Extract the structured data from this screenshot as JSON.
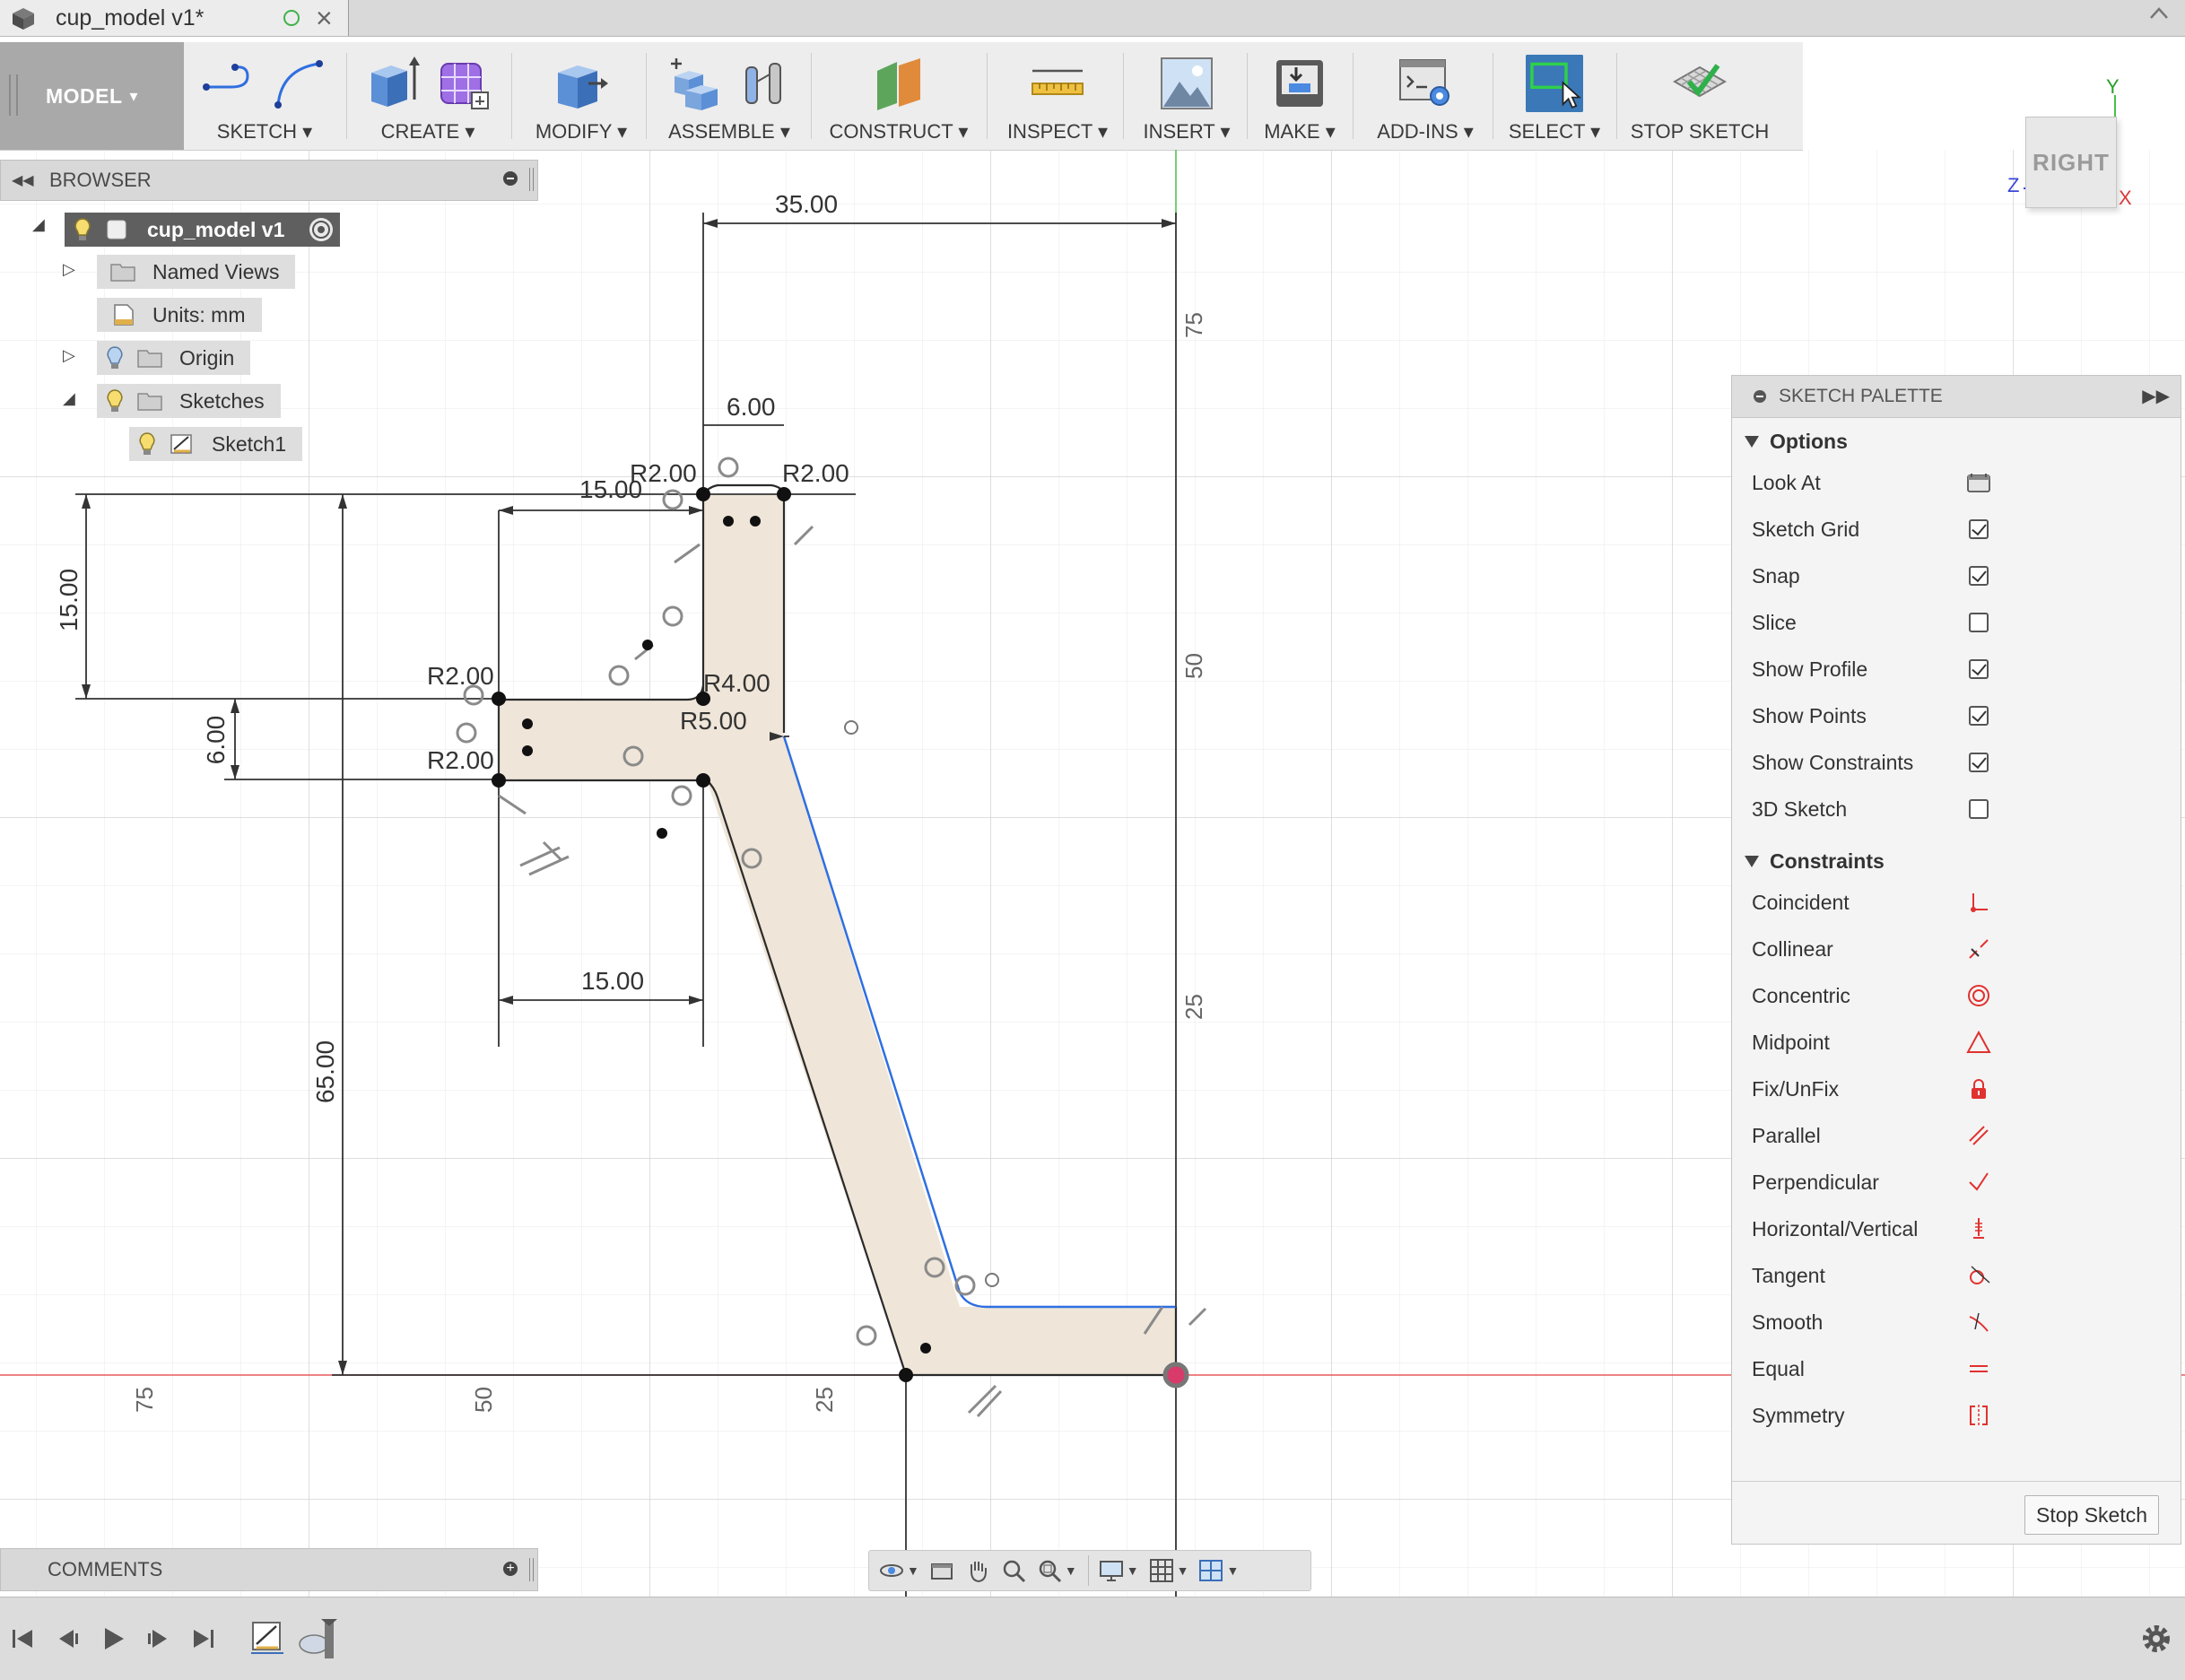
{
  "document": {
    "tab_title": "cup_model v1*",
    "close_glyph": "×"
  },
  "toolbar": {
    "workspace_label": "MODEL",
    "groups": [
      {
        "label": "SKETCH",
        "icons": [
          "line-icon",
          "arc-icon"
        ]
      },
      {
        "label": "CREATE",
        "icons": [
          "extrude-icon",
          "form-icon"
        ]
      },
      {
        "label": "MODIFY",
        "icons": [
          "press-pull-icon"
        ]
      },
      {
        "label": "ASSEMBLE",
        "icons": [
          "new-component-icon",
          "joint-icon"
        ]
      },
      {
        "label": "CONSTRUCT",
        "icons": [
          "offset-plane-icon"
        ]
      },
      {
        "label": "INSPECT",
        "icons": [
          "measure-icon"
        ]
      },
      {
        "label": "INSERT",
        "icons": [
          "insert-image-icon"
        ]
      },
      {
        "label": "MAKE",
        "icons": [
          "3d-print-icon"
        ]
      },
      {
        "label": "ADD-INS",
        "icons": [
          "scripts-icon"
        ]
      },
      {
        "label": "SELECT",
        "icons": [
          "select-icon"
        ]
      },
      {
        "label": "STOP SKETCH",
        "icons": [
          "stop-sketch-icon"
        ]
      }
    ],
    "caret": "▾"
  },
  "browser": {
    "title": "BROWSER",
    "nodes": {
      "root": "cup_model v1",
      "named_views": "Named Views",
      "units": "Units: mm",
      "origin": "Origin",
      "sketches": "Sketches",
      "sketch1": "Sketch1"
    }
  },
  "comments": {
    "title": "COMMENTS"
  },
  "view_cube": {
    "face": "RIGHT",
    "axis_y": "Y",
    "axis_z": "Z",
    "axis_x": "X"
  },
  "sketch_dimensions": {
    "width_top": "35.00",
    "neck_width": "6.00",
    "rim_offset": "15.00",
    "rim_height": "15.00",
    "flange_thickness": "6.00",
    "total_height": "65.00",
    "base_offset": "15.00",
    "radius_a": "R2.00",
    "radius_b": "R2.00",
    "radius_c": "R2.00",
    "radius_d": "R2.00",
    "radius_inner": "R4.00",
    "radius_outer": "R5.00"
  },
  "grid_labels": {
    "vertical_75": "75",
    "vertical_50": "50",
    "vertical_25": "25",
    "horizontal_75": "75",
    "horizontal_50": "50",
    "horizontal_25": "25"
  },
  "sketch_palette": {
    "title": "SKETCH PALETTE",
    "options_title": "Options",
    "options": [
      {
        "label": "Look At",
        "kind": "icon",
        "icon": "look-at-icon"
      },
      {
        "label": "Sketch Grid",
        "kind": "checkbox",
        "checked": true
      },
      {
        "label": "Snap",
        "kind": "checkbox",
        "checked": true
      },
      {
        "label": "Slice",
        "kind": "checkbox",
        "checked": false
      },
      {
        "label": "Show Profile",
        "kind": "checkbox",
        "checked": true
      },
      {
        "label": "Show Points",
        "kind": "checkbox",
        "checked": true
      },
      {
        "label": "Show Constraints",
        "kind": "checkbox",
        "checked": true
      },
      {
        "label": "3D Sketch",
        "kind": "checkbox",
        "checked": false
      }
    ],
    "constraints_title": "Constraints",
    "constraints": [
      {
        "label": "Coincident",
        "icon": "coincident-icon"
      },
      {
        "label": "Collinear",
        "icon": "collinear-icon"
      },
      {
        "label": "Concentric",
        "icon": "concentric-icon"
      },
      {
        "label": "Midpoint",
        "icon": "midpoint-icon"
      },
      {
        "label": "Fix/UnFix",
        "icon": "fix-unfix-icon"
      },
      {
        "label": "Parallel",
        "icon": "parallel-icon"
      },
      {
        "label": "Perpendicular",
        "icon": "perpendicular-icon"
      },
      {
        "label": "Horizontal/Vertical",
        "icon": "horizontal-vertical-icon"
      },
      {
        "label": "Tangent",
        "icon": "tangent-icon"
      },
      {
        "label": "Smooth",
        "icon": "smooth-icon"
      },
      {
        "label": "Equal",
        "icon": "equal-icon"
      },
      {
        "label": "Symmetry",
        "icon": "symmetry-icon"
      }
    ],
    "stop_button": "Stop Sketch"
  },
  "colors": {
    "accent_select": "#3b78b7",
    "constraint_red": "#e0322f",
    "profile_fill": "#efe5d8",
    "sketch_blue": "#2f6fe0",
    "axis_red": "#e85a5a",
    "axis_green": "#48c048"
  }
}
